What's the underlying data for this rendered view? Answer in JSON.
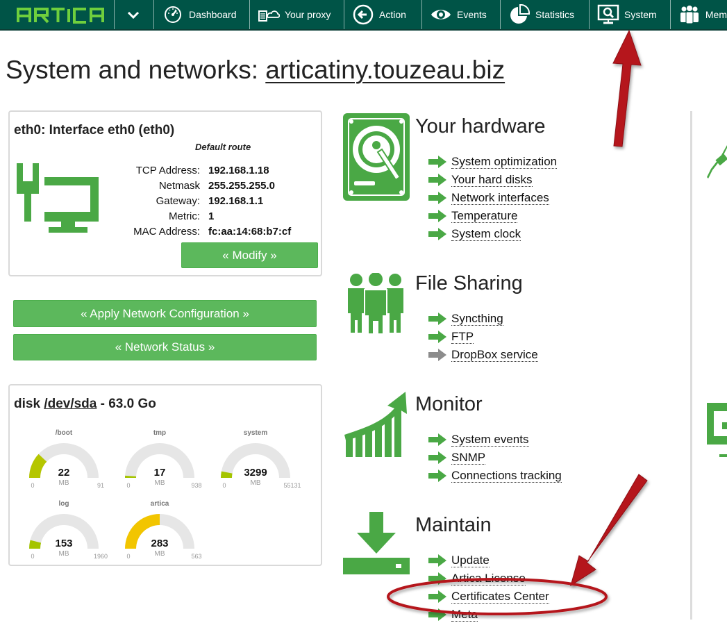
{
  "app": {
    "logo_text": "ARTICA"
  },
  "nav": {
    "items": [
      {
        "label": "Dashboard",
        "icon": "dashboard-gauge-icon"
      },
      {
        "label": "Your proxy",
        "icon": "proxy-server-icon"
      },
      {
        "label": "Action",
        "icon": "action-arrow-icon"
      },
      {
        "label": "Events",
        "icon": "eye-icon"
      },
      {
        "label": "Statistics",
        "icon": "pie-chart-icon"
      },
      {
        "label": "System",
        "icon": "system-monitor-icon"
      },
      {
        "label": "Mem",
        "icon": "members-icon"
      }
    ]
  },
  "page": {
    "title_prefix": "System and networks: ",
    "hostname": "articatiny.touzeau.biz"
  },
  "interface": {
    "title": "eth0: Interface eth0 (eth0)",
    "default_route": "Default route",
    "rows": [
      {
        "label": "TCP Address:",
        "value": "192.168.1.18"
      },
      {
        "label": "Netmask",
        "value": "255.255.255.0"
      },
      {
        "label": "Gateway:",
        "value": "192.168.1.1"
      },
      {
        "label": "Metric:",
        "value": "1"
      },
      {
        "label": "MAC Address:",
        "value": "fc:aa:14:68:b7:cf"
      }
    ],
    "modify_label": "« Modify »"
  },
  "actions": {
    "apply_label": "« Apply Network Configuration »",
    "status_label": "« Network Status »"
  },
  "disk": {
    "title_prefix": "disk ",
    "device": "/dev/sda",
    "title_suffix": " - 63.0 Go",
    "gauges": [
      {
        "name": "/boot",
        "value": "22",
        "unit": "MB",
        "min": "0",
        "max": "91",
        "fraction": 0.24,
        "color": "#b5c600"
      },
      {
        "name": "tmp",
        "value": "17",
        "unit": "MB",
        "min": "0",
        "max": "938",
        "fraction": 0.02,
        "color": "#a4c400"
      },
      {
        "name": "system",
        "value": "3299",
        "unit": "MB",
        "min": "0",
        "max": "55131",
        "fraction": 0.06,
        "color": "#a4c400"
      },
      {
        "name": "log",
        "value": "153",
        "unit": "MB",
        "min": "0",
        "max": "1960",
        "fraction": 0.08,
        "color": "#a4c400"
      },
      {
        "name": "artica",
        "value": "283",
        "unit": "MB",
        "min": "0",
        "max": "563",
        "fraction": 0.5,
        "color": "#f2c500"
      }
    ]
  },
  "sections": {
    "hardware": {
      "title": "Your hardware",
      "links": [
        "System optimization",
        "Your hard disks",
        "Network interfaces",
        "Temperature",
        "System clock"
      ]
    },
    "sharing": {
      "title": "File Sharing",
      "links": [
        "Syncthing",
        "FTP",
        "DropBox service"
      ]
    },
    "monitor": {
      "title": "Monitor",
      "links": [
        "System events",
        "SNMP",
        "Connections tracking"
      ]
    },
    "maintain": {
      "title": "Maintain",
      "links": [
        "Update",
        "Artica License",
        "Certificates Center",
        "Meta"
      ]
    }
  },
  "colors": {
    "nav_bg": "#005447",
    "accent_green": "#4aa845",
    "button_green": "#5cb85c",
    "annotation_red": "#b5161b",
    "disabled_arrow": "#8c8c8c"
  }
}
